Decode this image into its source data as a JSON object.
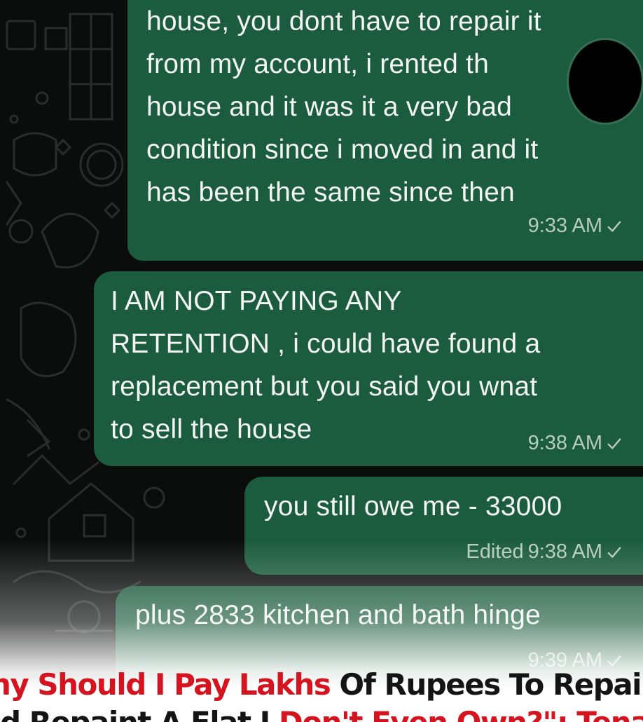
{
  "messages": [
    {
      "lines": [
        "house, you dont have to repair it",
        "from my account, i rented th",
        "house and it was it a very bad",
        "condition since i moved in and it",
        "has been the same since then"
      ],
      "edited": "",
      "time": "9:33 AM"
    },
    {
      "lines": [
        "I AM NOT PAYING ANY",
        "RETENTION , i could have found a",
        "replacement but you said you wnat",
        "to sell the house"
      ],
      "edited": "",
      "time": "9:38 AM"
    },
    {
      "lines": [
        "you still owe me - 33000"
      ],
      "edited": "Edited",
      "time": "9:38 AM"
    },
    {
      "lines": [
        "plus 2833 kitchen and bath hinge"
      ],
      "edited": "",
      "time": "9:39 AM"
    }
  ],
  "caption": {
    "line1_red": "hy Should I Pay Lakhs",
    "line1_black": " Of Rupees To Repair",
    "line2_black": "d Repaint A Flat I ",
    "line2_red": "Don't Even Own?\": Tenant"
  },
  "colors": {
    "bubble": "#1c5c3e",
    "background": "#0b0d0c",
    "caption_red": "#d5141f",
    "caption_black": "#141414"
  }
}
